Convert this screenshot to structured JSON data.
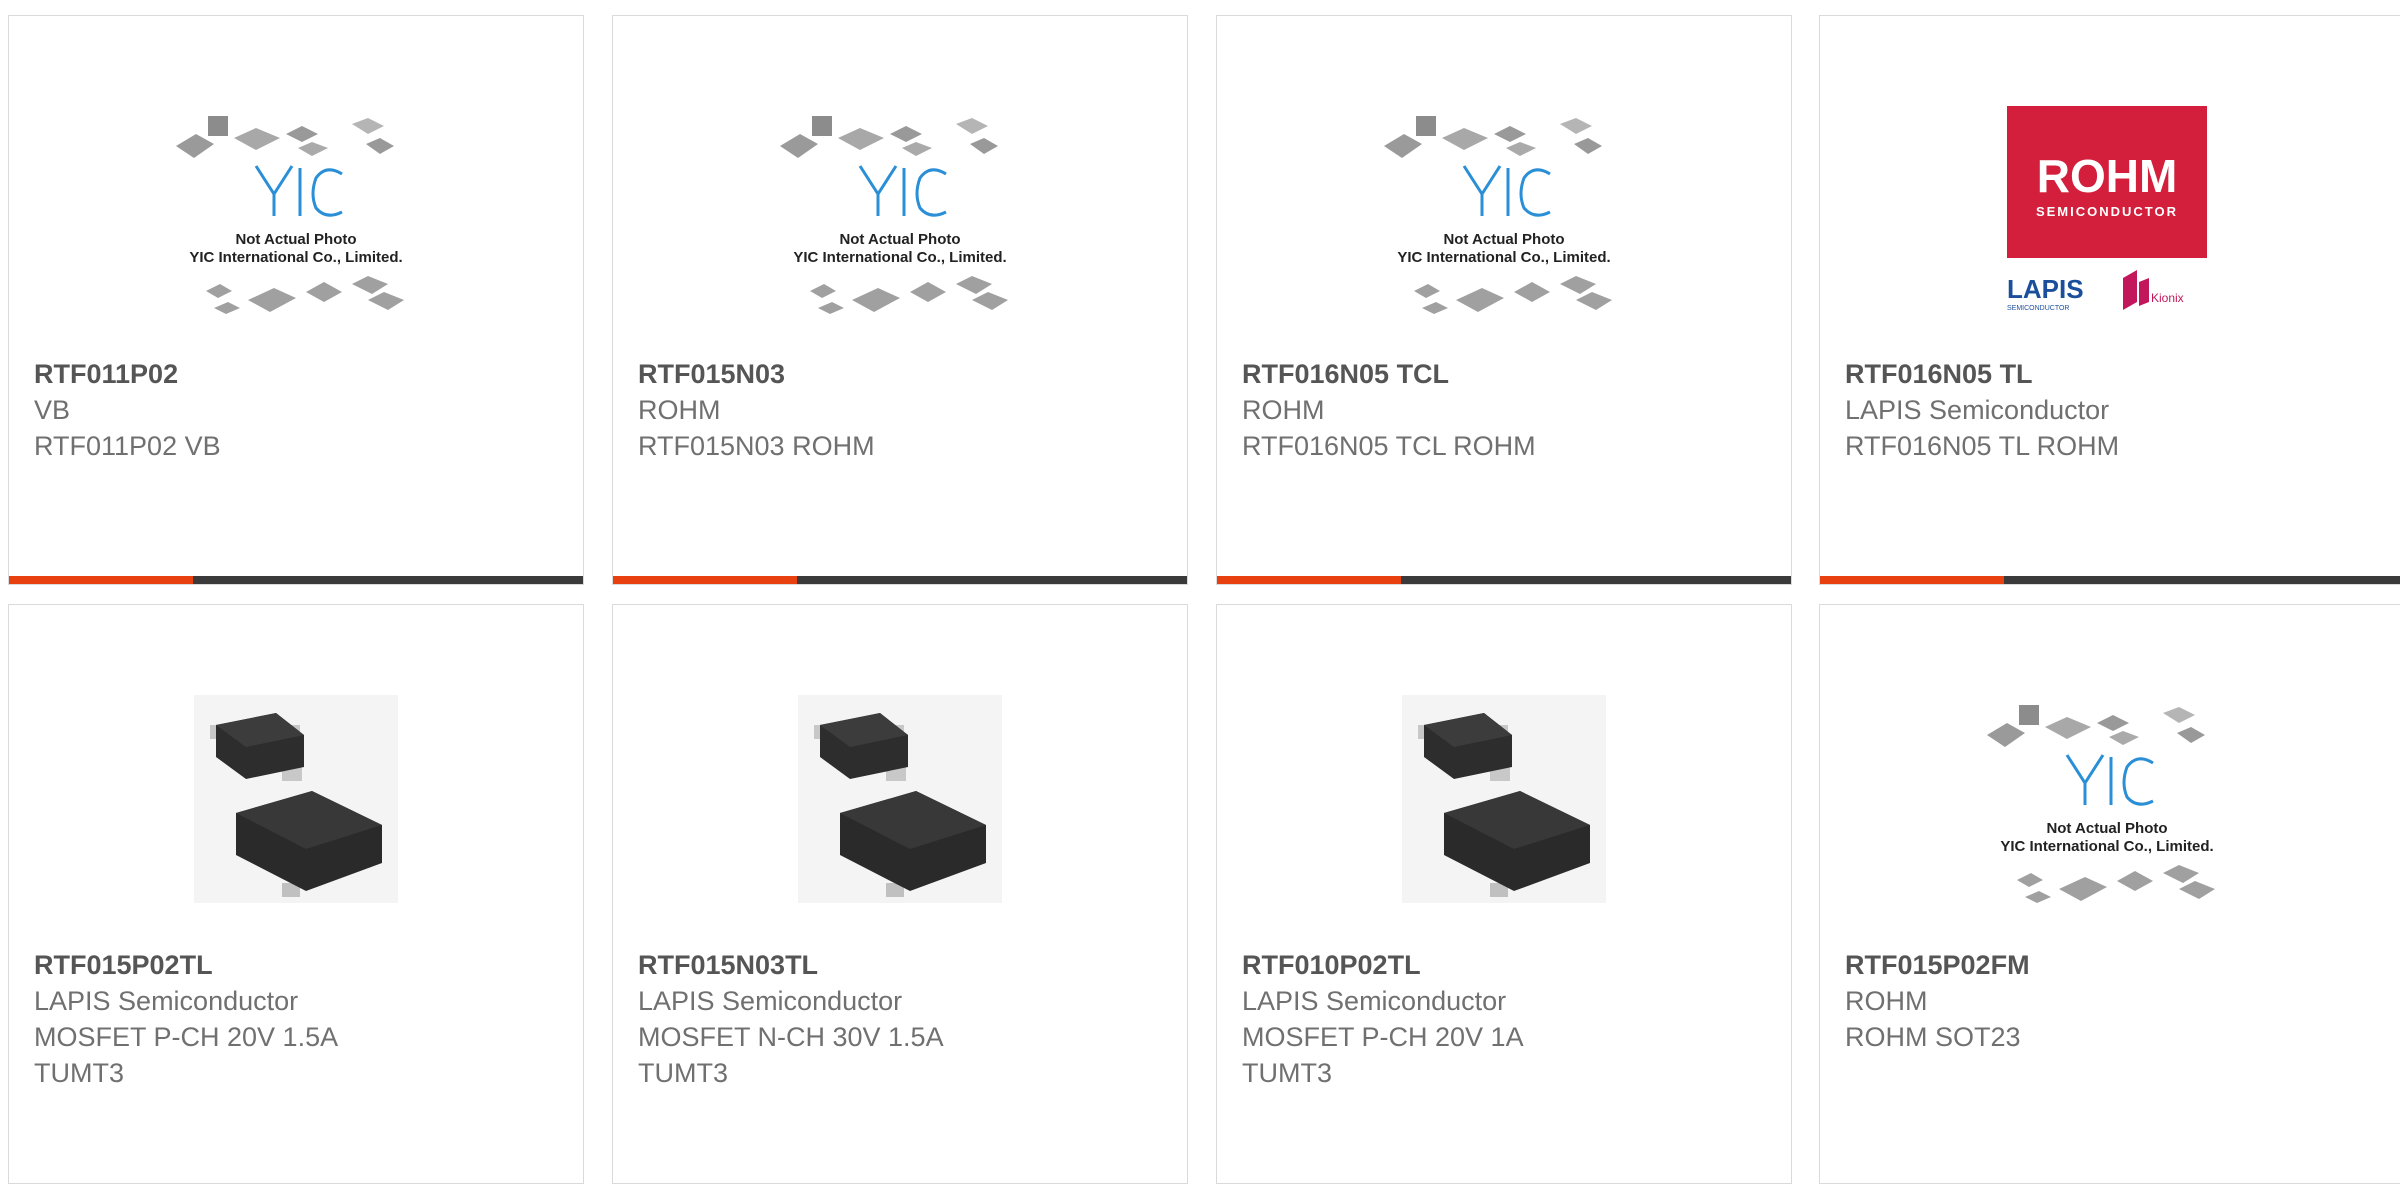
{
  "products": [
    {
      "part": "RTF011P02",
      "brand": "VB",
      "desc": "RTF011P02 VB",
      "image": "placeholder"
    },
    {
      "part": "RTF015N03",
      "brand": "ROHM",
      "desc": "RTF015N03 ROHM",
      "image": "placeholder"
    },
    {
      "part": "RTF016N05 TCL",
      "brand": "ROHM",
      "desc": "RTF016N05 TCL ROHM",
      "image": "placeholder"
    },
    {
      "part": "RTF016N05 TL",
      "brand": "LAPIS Semiconductor",
      "desc": "RTF016N05 TL ROHM",
      "image": "rohm-logo"
    },
    {
      "part": "RTF015P02TL",
      "brand": "LAPIS Semiconductor",
      "desc": "MOSFET P-CH 20V 1.5A TUMT3",
      "image": "tumt3-package"
    },
    {
      "part": "RTF015N03TL",
      "brand": "LAPIS Semiconductor",
      "desc": "MOSFET N-CH 30V 1.5A TUMT3",
      "image": "tumt3-package"
    },
    {
      "part": "RTF010P02TL",
      "brand": "LAPIS Semiconductor",
      "desc": "MOSFET P-CH 20V 1A TUMT3",
      "image": "tumt3-package"
    },
    {
      "part": "RTF015P02FM",
      "brand": "ROHM",
      "desc": "ROHM SOT23",
      "image": "placeholder"
    }
  ],
  "placeholder": {
    "logo": "YIC",
    "line1": "Not Actual Photo",
    "line2": "YIC International Co., Limited."
  },
  "rohm_logo": {
    "name": "ROHM",
    "tagline": "SEMICONDUCTOR",
    "lapis": "LAPIS",
    "lapis_tag": "SEMICONDUCTOR",
    "kionix": "Kionix"
  },
  "colors": {
    "accent": "#e8410f",
    "bar": "#3a3a3a",
    "rohm_red": "#d31f3b",
    "lapis_blue": "#1b4f9c",
    "kionix_pink": "#c2185b",
    "yic_blue": "#2a8fd6"
  }
}
